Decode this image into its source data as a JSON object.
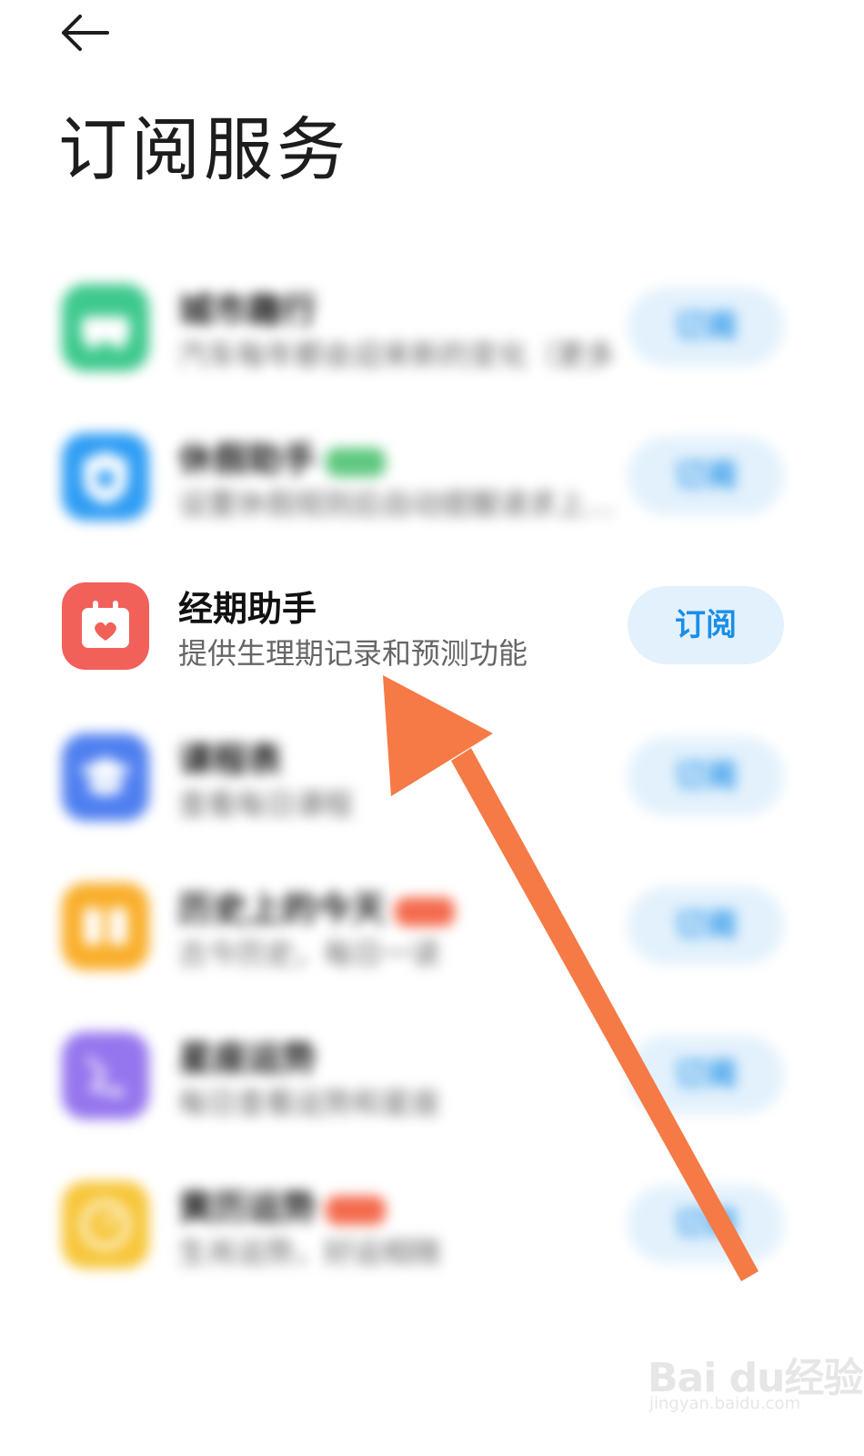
{
  "header": {
    "back_icon": "arrow-left-icon",
    "title": "订阅服务"
  },
  "colors": {
    "subscribe_bg": "#e3f1fc",
    "subscribe_text": "#1a8ee8",
    "annotation_arrow": "#f57a46"
  },
  "services": [
    {
      "name": "城市趣行",
      "desc": "汽车每年都会迎来新的变化（更多点…",
      "button": "订阅",
      "icon": "car-icon",
      "color": "#3ec98e",
      "badge": null,
      "blurred": true
    },
    {
      "name": "休假助手",
      "desc": "设置休假规则后自动提醒请求上…",
      "button": "订阅",
      "icon": "shield-clock-icon",
      "color": "#2f9df4",
      "badge": "#5fc87f",
      "blurred": true
    },
    {
      "name": "经期助手",
      "desc": "提供生理期记录和预测功能",
      "button": "订阅",
      "icon": "calendar-heart-icon",
      "color": "#f2605a",
      "badge": null,
      "blurred": false
    },
    {
      "name": "课程表",
      "desc": "查看每日课程",
      "button": "订阅",
      "icon": "graduation-cap-icon",
      "color": "#4f7ff0",
      "badge": null,
      "blurred": true
    },
    {
      "name": "历史上的今天",
      "desc": "古今历史，每日一读",
      "button": "订阅",
      "icon": "book-icon",
      "color": "#f9ae2a",
      "badge": "#f46b4e",
      "blurred": true
    },
    {
      "name": "星座运势",
      "desc": "每日查看运势和星座",
      "button": "订阅",
      "icon": "constellation-icon",
      "color": "#9676ee",
      "badge": null,
      "blurred": true
    },
    {
      "name": "黄历运势",
      "desc": "生肖运势，好运相随",
      "button": "订阅",
      "icon": "clock-icon",
      "color": "#f7c63a",
      "badge": "#f46b4e",
      "blurred": true
    }
  ],
  "watermark": {
    "logo": "Bai du经验",
    "url": "jingyan.baidu.com"
  }
}
